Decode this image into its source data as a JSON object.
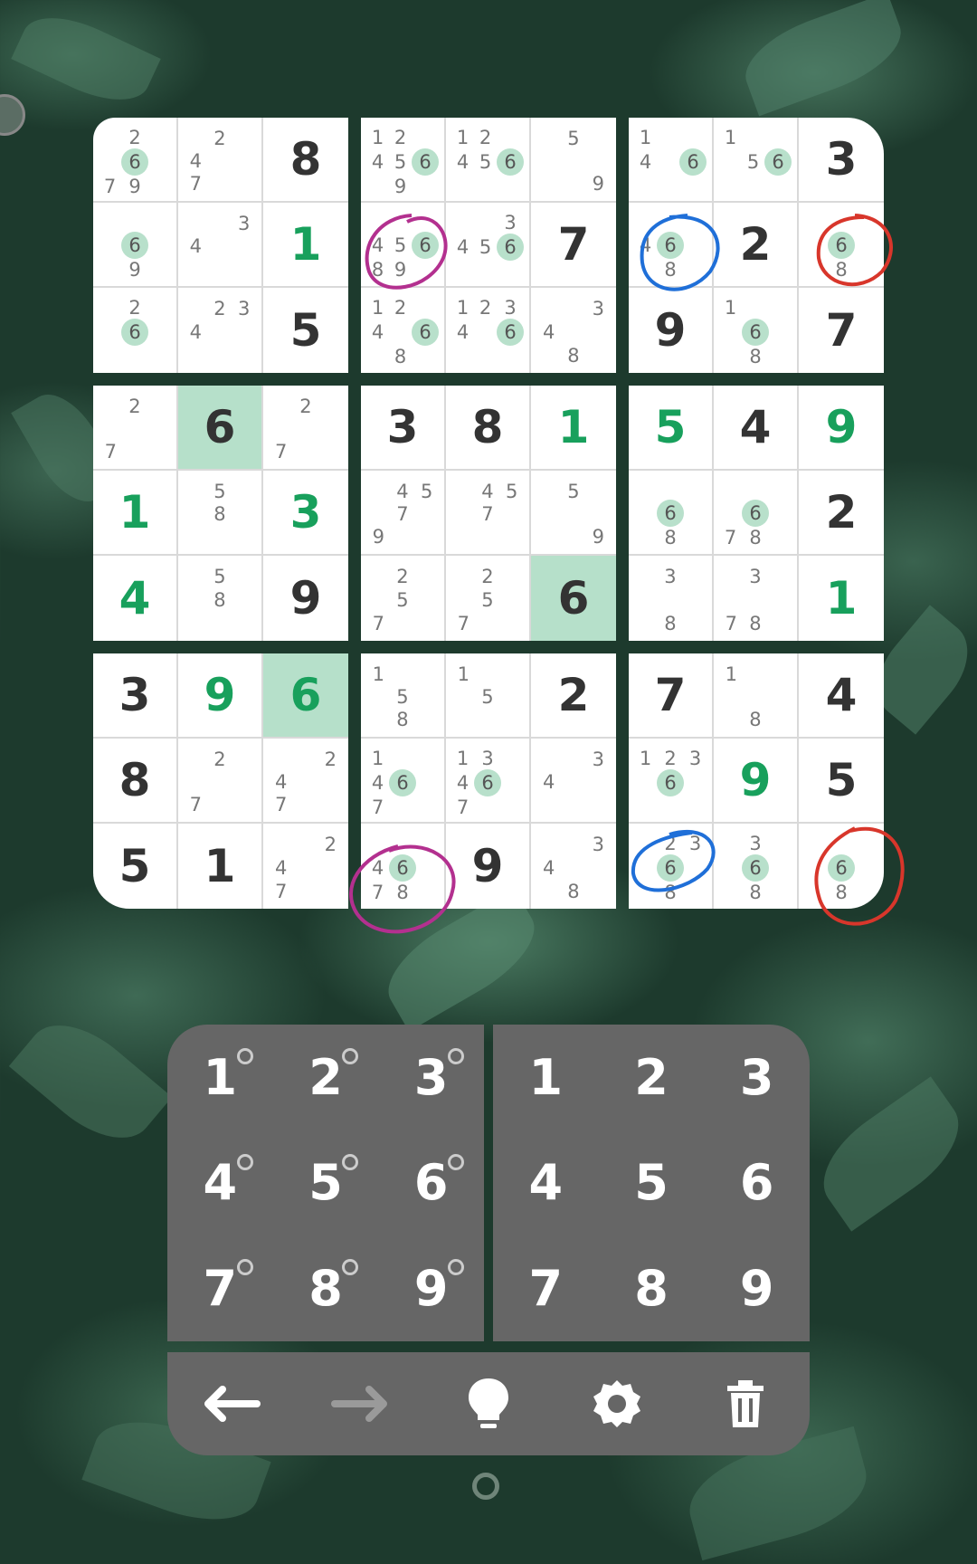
{
  "board": {
    "boxes": [
      {
        "cells": [
          {
            "v": "",
            "c": [
              "",
              "2",
              "",
              "",
              "6",
              "",
              "7",
              "9",
              ""
            ],
            "m": "6"
          },
          {
            "v": "",
            "c": [
              "",
              "2",
              "",
              "4",
              "",
              "",
              "7",
              "",
              ""
            ]
          },
          {
            "v": "8",
            "t": "given"
          },
          {
            "v": "",
            "c": [
              "",
              "",
              "",
              "",
              "6",
              "",
              "",
              "9",
              ""
            ],
            "m": "6"
          },
          {
            "v": "",
            "c": [
              "",
              "",
              "3",
              "4",
              "",
              "",
              "",
              "",
              ""
            ]
          },
          {
            "v": "1",
            "t": "user"
          },
          {
            "v": "",
            "c": [
              "",
              "2",
              "",
              "",
              "6",
              "",
              "",
              "",
              ""
            ],
            "m": "6"
          },
          {
            "v": "",
            "c": [
              "",
              "2",
              "3",
              "4",
              "",
              "",
              "",
              "",
              ""
            ]
          },
          {
            "v": "5",
            "t": "given"
          }
        ]
      },
      {
        "cells": [
          {
            "v": "",
            "c": [
              "1",
              "2",
              "",
              "4",
              "5",
              "6",
              "",
              "9",
              ""
            ],
            "m": "6"
          },
          {
            "v": "",
            "c": [
              "1",
              "2",
              "",
              "4",
              "5",
              "6",
              "",
              "",
              ""
            ],
            "m": "6"
          },
          {
            "v": "",
            "c": [
              "",
              "5",
              "",
              "",
              "",
              "",
              "",
              "",
              "9"
            ]
          },
          {
            "v": "",
            "c": [
              "",
              "",
              "",
              "4",
              "5",
              "6",
              "8",
              "9",
              ""
            ],
            "m": "6"
          },
          {
            "v": "",
            "c": [
              "",
              "",
              "3",
              "4",
              "5",
              "6",
              "",
              "",
              ""
            ],
            "m": "6"
          },
          {
            "v": "7",
            "t": "given"
          },
          {
            "v": "",
            "c": [
              "1",
              "2",
              "",
              "4",
              "",
              "6",
              "",
              "8",
              ""
            ],
            "m": "6"
          },
          {
            "v": "",
            "c": [
              "1",
              "2",
              "3",
              "4",
              "",
              "6",
              "",
              "",
              ""
            ],
            "m": "6"
          },
          {
            "v": "",
            "c": [
              "",
              "",
              "3",
              "4",
              "",
              "",
              "",
              "8",
              ""
            ]
          }
        ]
      },
      {
        "cells": [
          {
            "v": "",
            "c": [
              "1",
              "",
              "",
              "4",
              "",
              "6",
              "",
              "",
              ""
            ],
            "m": "6"
          },
          {
            "v": "",
            "c": [
              "1",
              "",
              "",
              "",
              "5",
              "6",
              "",
              "",
              ""
            ],
            "m": "6"
          },
          {
            "v": "3",
            "t": "given"
          },
          {
            "v": "",
            "c": [
              "",
              "",
              "",
              "4",
              "6",
              "",
              "",
              "8",
              ""
            ],
            "m": "6"
          },
          {
            "v": "2",
            "t": "given"
          },
          {
            "v": "",
            "c": [
              "",
              "",
              "",
              "",
              "6",
              "",
              "",
              "8",
              ""
            ],
            "m": "6"
          },
          {
            "v": "9",
            "t": "given"
          },
          {
            "v": "",
            "c": [
              "1",
              "",
              "",
              "",
              "6",
              "",
              "",
              "8",
              ""
            ],
            "m": "6"
          },
          {
            "v": "7",
            "t": "given"
          }
        ]
      },
      {
        "cells": [
          {
            "v": "",
            "c": [
              "",
              "2",
              "",
              "",
              "",
              "",
              "7",
              "",
              ""
            ]
          },
          {
            "v": "6",
            "t": "given",
            "hl": true
          },
          {
            "v": "",
            "c": [
              "",
              "2",
              "",
              "",
              "",
              "",
              "7",
              "",
              ""
            ]
          },
          {
            "v": "1",
            "t": "user"
          },
          {
            "v": "",
            "c": [
              "",
              "5",
              "",
              "",
              "8",
              "",
              "",
              "",
              ""
            ]
          },
          {
            "v": "3",
            "t": "user"
          },
          {
            "v": "4",
            "t": "user"
          },
          {
            "v": "",
            "c": [
              "",
              "5",
              "",
              "",
              "8",
              "",
              "",
              "",
              ""
            ]
          },
          {
            "v": "9",
            "t": "given"
          }
        ]
      },
      {
        "cells": [
          {
            "v": "3",
            "t": "given"
          },
          {
            "v": "8",
            "t": "given"
          },
          {
            "v": "1",
            "t": "user"
          },
          {
            "v": "",
            "c": [
              "",
              "4",
              "5",
              "",
              "7",
              "",
              "9",
              "",
              ""
            ]
          },
          {
            "v": "",
            "c": [
              "",
              "4",
              "5",
              "",
              "7",
              "",
              "",
              "",
              ""
            ]
          },
          {
            "v": "",
            "c": [
              "",
              "5",
              "",
              "",
              "",
              "",
              "",
              "",
              "9"
            ]
          },
          {
            "v": "",
            "c": [
              "",
              "2",
              "",
              "",
              "5",
              "",
              "7",
              "",
              ""
            ]
          },
          {
            "v": "",
            "c": [
              "",
              "2",
              "",
              "",
              "5",
              "",
              "7",
              "",
              ""
            ]
          },
          {
            "v": "6",
            "t": "given",
            "hl": true
          }
        ]
      },
      {
        "cells": [
          {
            "v": "5",
            "t": "user"
          },
          {
            "v": "4",
            "t": "given"
          },
          {
            "v": "9",
            "t": "user"
          },
          {
            "v": "",
            "c": [
              "",
              "",
              "",
              "",
              "6",
              "",
              "",
              "8",
              ""
            ],
            "m": "6"
          },
          {
            "v": "",
            "c": [
              "",
              "",
              "",
              "",
              "6",
              "",
              "7",
              "8",
              ""
            ],
            "m": "6"
          },
          {
            "v": "2",
            "t": "given"
          },
          {
            "v": "",
            "c": [
              "",
              "3",
              "",
              "",
              "",
              "",
              "",
              "8",
              ""
            ]
          },
          {
            "v": "",
            "c": [
              "",
              "3",
              "",
              "",
              "",
              "",
              "7",
              "8",
              ""
            ]
          },
          {
            "v": "1",
            "t": "user"
          }
        ]
      },
      {
        "cells": [
          {
            "v": "3",
            "t": "given"
          },
          {
            "v": "9",
            "t": "user"
          },
          {
            "v": "6",
            "t": "user",
            "hl": true
          },
          {
            "v": "8",
            "t": "given"
          },
          {
            "v": "",
            "c": [
              "",
              "2",
              "",
              "",
              "",
              "",
              "7",
              "",
              ""
            ]
          },
          {
            "v": "",
            "c": [
              "",
              "",
              "2",
              "4",
              "",
              "",
              "7",
              "",
              ""
            ]
          },
          {
            "v": "5",
            "t": "given"
          },
          {
            "v": "1",
            "t": "given"
          },
          {
            "v": "",
            "c": [
              "",
              "",
              "2",
              "4",
              "",
              "",
              "7",
              "",
              ""
            ]
          }
        ]
      },
      {
        "cells": [
          {
            "v": "",
            "c": [
              "1",
              "",
              "",
              "",
              "5",
              "",
              "",
              "8",
              ""
            ]
          },
          {
            "v": "",
            "c": [
              "1",
              "",
              "",
              "",
              "5",
              "",
              "",
              "",
              ""
            ]
          },
          {
            "v": "2",
            "t": "given"
          },
          {
            "v": "",
            "c": [
              "1",
              "",
              "",
              "4",
              "6",
              "",
              "7",
              "",
              ""
            ],
            "m": "6"
          },
          {
            "v": "",
            "c": [
              "1",
              "3",
              "",
              "4",
              "6",
              "",
              "7",
              "",
              ""
            ],
            "m": "6"
          },
          {
            "v": "",
            "c": [
              "",
              "",
              "3",
              "4",
              "",
              "",
              "",
              "",
              ""
            ]
          },
          {
            "v": "",
            "c": [
              "",
              "",
              "",
              "4",
              "6",
              "",
              "7",
              "8",
              ""
            ],
            "m": "6"
          },
          {
            "v": "9",
            "t": "given"
          },
          {
            "v": "",
            "c": [
              "",
              "",
              "3",
              "4",
              "",
              "",
              "",
              "8",
              ""
            ]
          }
        ]
      },
      {
        "cells": [
          {
            "v": "7",
            "t": "given"
          },
          {
            "v": "",
            "c": [
              "1",
              "",
              "",
              "",
              "",
              "",
              "",
              "8",
              ""
            ]
          },
          {
            "v": "4",
            "t": "given"
          },
          {
            "v": "",
            "c": [
              "1",
              "2",
              "3",
              "",
              "6",
              "",
              "",
              "",
              ""
            ],
            "m": "6"
          },
          {
            "v": "9",
            "t": "user"
          },
          {
            "v": "5",
            "t": "given"
          },
          {
            "v": "",
            "c": [
              "",
              "2",
              "3",
              "",
              "6",
              "",
              "",
              "8",
              ""
            ],
            "m": "6"
          },
          {
            "v": "",
            "c": [
              "",
              "3",
              "",
              "",
              "6",
              "",
              "",
              "8",
              ""
            ],
            "m": "6"
          },
          {
            "v": "",
            "c": [
              "",
              "",
              "",
              "",
              "6",
              "",
              "",
              "8",
              ""
            ],
            "m": "6"
          }
        ]
      }
    ]
  },
  "candidate_pad": {
    "keys": [
      "1",
      "2",
      "3",
      "4",
      "5",
      "6",
      "7",
      "8",
      "9"
    ]
  },
  "value_pad": {
    "keys": [
      "1",
      "2",
      "3",
      "4",
      "5",
      "6",
      "7",
      "8",
      "9"
    ]
  },
  "toolbar": {
    "buttons": [
      "arrow-left-icon",
      "arrow-right-icon",
      "lightbulb-icon",
      "gear-icon",
      "trash-icon"
    ]
  },
  "colors": {
    "accent": "#18a05c",
    "highlight": "#b6e0ca",
    "pad": "#666666",
    "circle_magenta": "#b3308f",
    "circle_blue": "#1f6fd8",
    "circle_red": "#d8362b"
  }
}
